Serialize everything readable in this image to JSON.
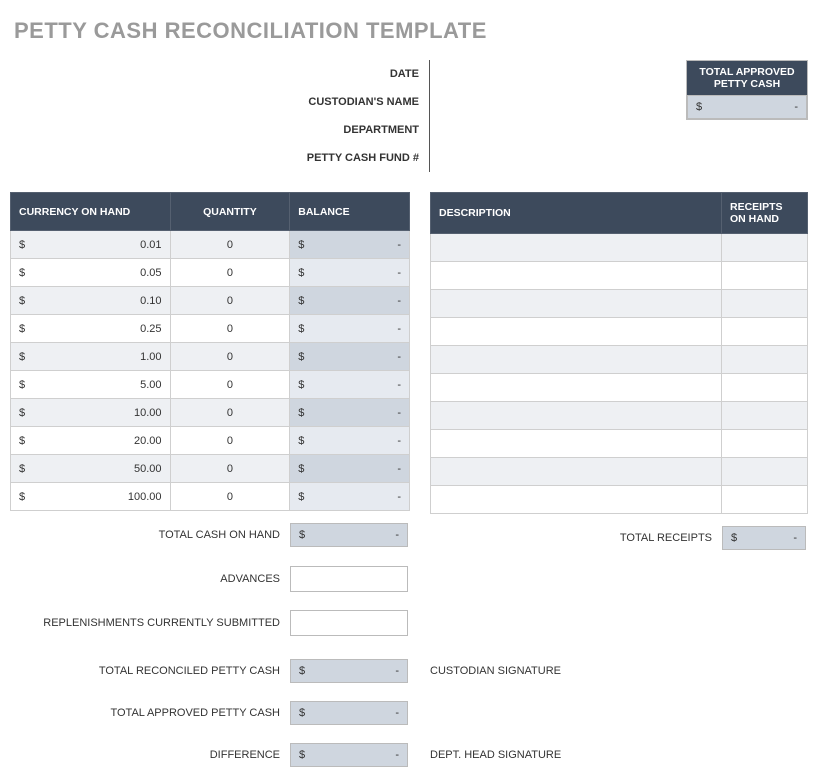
{
  "title": "PETTY CASH RECONCILIATION TEMPLATE",
  "top": {
    "date": "DATE",
    "custodian": "CUSTODIAN'S NAME",
    "department": "DEPARTMENT",
    "fund": "PETTY CASH FUND #"
  },
  "approved_box": {
    "header": "TOTAL APPROVED PETTY CASH",
    "sym": "$",
    "val": "-"
  },
  "currency_table": {
    "headers": {
      "c0": "CURRENCY ON HAND",
      "c1": "QUANTITY",
      "c2": "BALANCE"
    },
    "sym": "$",
    "rows": [
      {
        "denom": "0.01",
        "qty": "0",
        "bal": "-"
      },
      {
        "denom": "0.05",
        "qty": "0",
        "bal": "-"
      },
      {
        "denom": "0.10",
        "qty": "0",
        "bal": "-"
      },
      {
        "denom": "0.25",
        "qty": "0",
        "bal": "-"
      },
      {
        "denom": "1.00",
        "qty": "0",
        "bal": "-"
      },
      {
        "denom": "5.00",
        "qty": "0",
        "bal": "-"
      },
      {
        "denom": "10.00",
        "qty": "0",
        "bal": "-"
      },
      {
        "denom": "20.00",
        "qty": "0",
        "bal": "-"
      },
      {
        "denom": "50.00",
        "qty": "0",
        "bal": "-"
      },
      {
        "denom": "100.00",
        "qty": "0",
        "bal": "-"
      }
    ]
  },
  "receipts_table": {
    "headers": {
      "c0": "DESCRIPTION",
      "c1": "RECEIPTS ON HAND"
    }
  },
  "labels": {
    "total_cash_on_hand": "TOTAL CASH ON HAND",
    "advances": "ADVANCES",
    "replenishments": "REPLENISHMENTS CURRENTLY SUBMITTED",
    "total_reconciled": "TOTAL RECONCILED PETTY CASH",
    "total_approved": "TOTAL APPROVED PETTY CASH",
    "difference": "DIFFERENCE",
    "total_receipts": "TOTAL RECEIPTS",
    "custodian_sig": "CUSTODIAN SIGNATURE",
    "dept_sig": "DEPT. HEAD SIGNATURE"
  },
  "money": {
    "sym": "$",
    "dash": "-"
  }
}
